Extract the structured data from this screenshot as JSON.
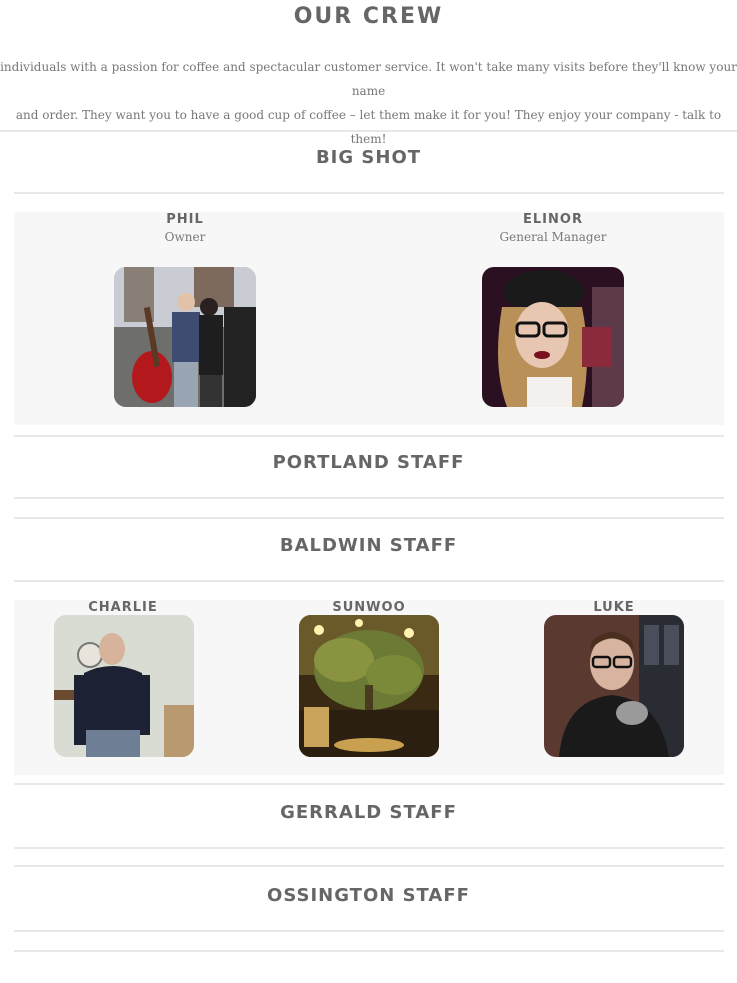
{
  "header": {
    "title": "OUR CREW",
    "intro_line1": "individuals with a passion for coffee and spectacular customer service. It won't take many visits before they'll know your name",
    "intro_line2": "and order. They want you to have a good cup of coffee – let them make it for you! They enjoy your company - talk to them!"
  },
  "sections": {
    "big_shot": {
      "title": "BIG SHOT",
      "members": [
        {
          "name": "PHIL",
          "role": "Owner",
          "photo": "photo-of-phil-with-guitar"
        },
        {
          "name": "ELINOR",
          "role": "General Manager",
          "photo": "photo-of-elinor-with-glasses"
        }
      ]
    },
    "portland": {
      "title": "PORTLAND STAFF"
    },
    "baldwin": {
      "title": "BALDWIN STAFF",
      "members": [
        {
          "name": "CHARLIE",
          "photo": "photo-of-charlie"
        },
        {
          "name": "SUNWOO",
          "photo": "photo-of-cafe-interior"
        },
        {
          "name": "LUKE",
          "photo": "photo-of-luke-with-glasses"
        }
      ]
    },
    "gerrald": {
      "title": "GERRALD STAFF"
    },
    "ossington": {
      "title": "OSSINGTON STAFF"
    }
  }
}
